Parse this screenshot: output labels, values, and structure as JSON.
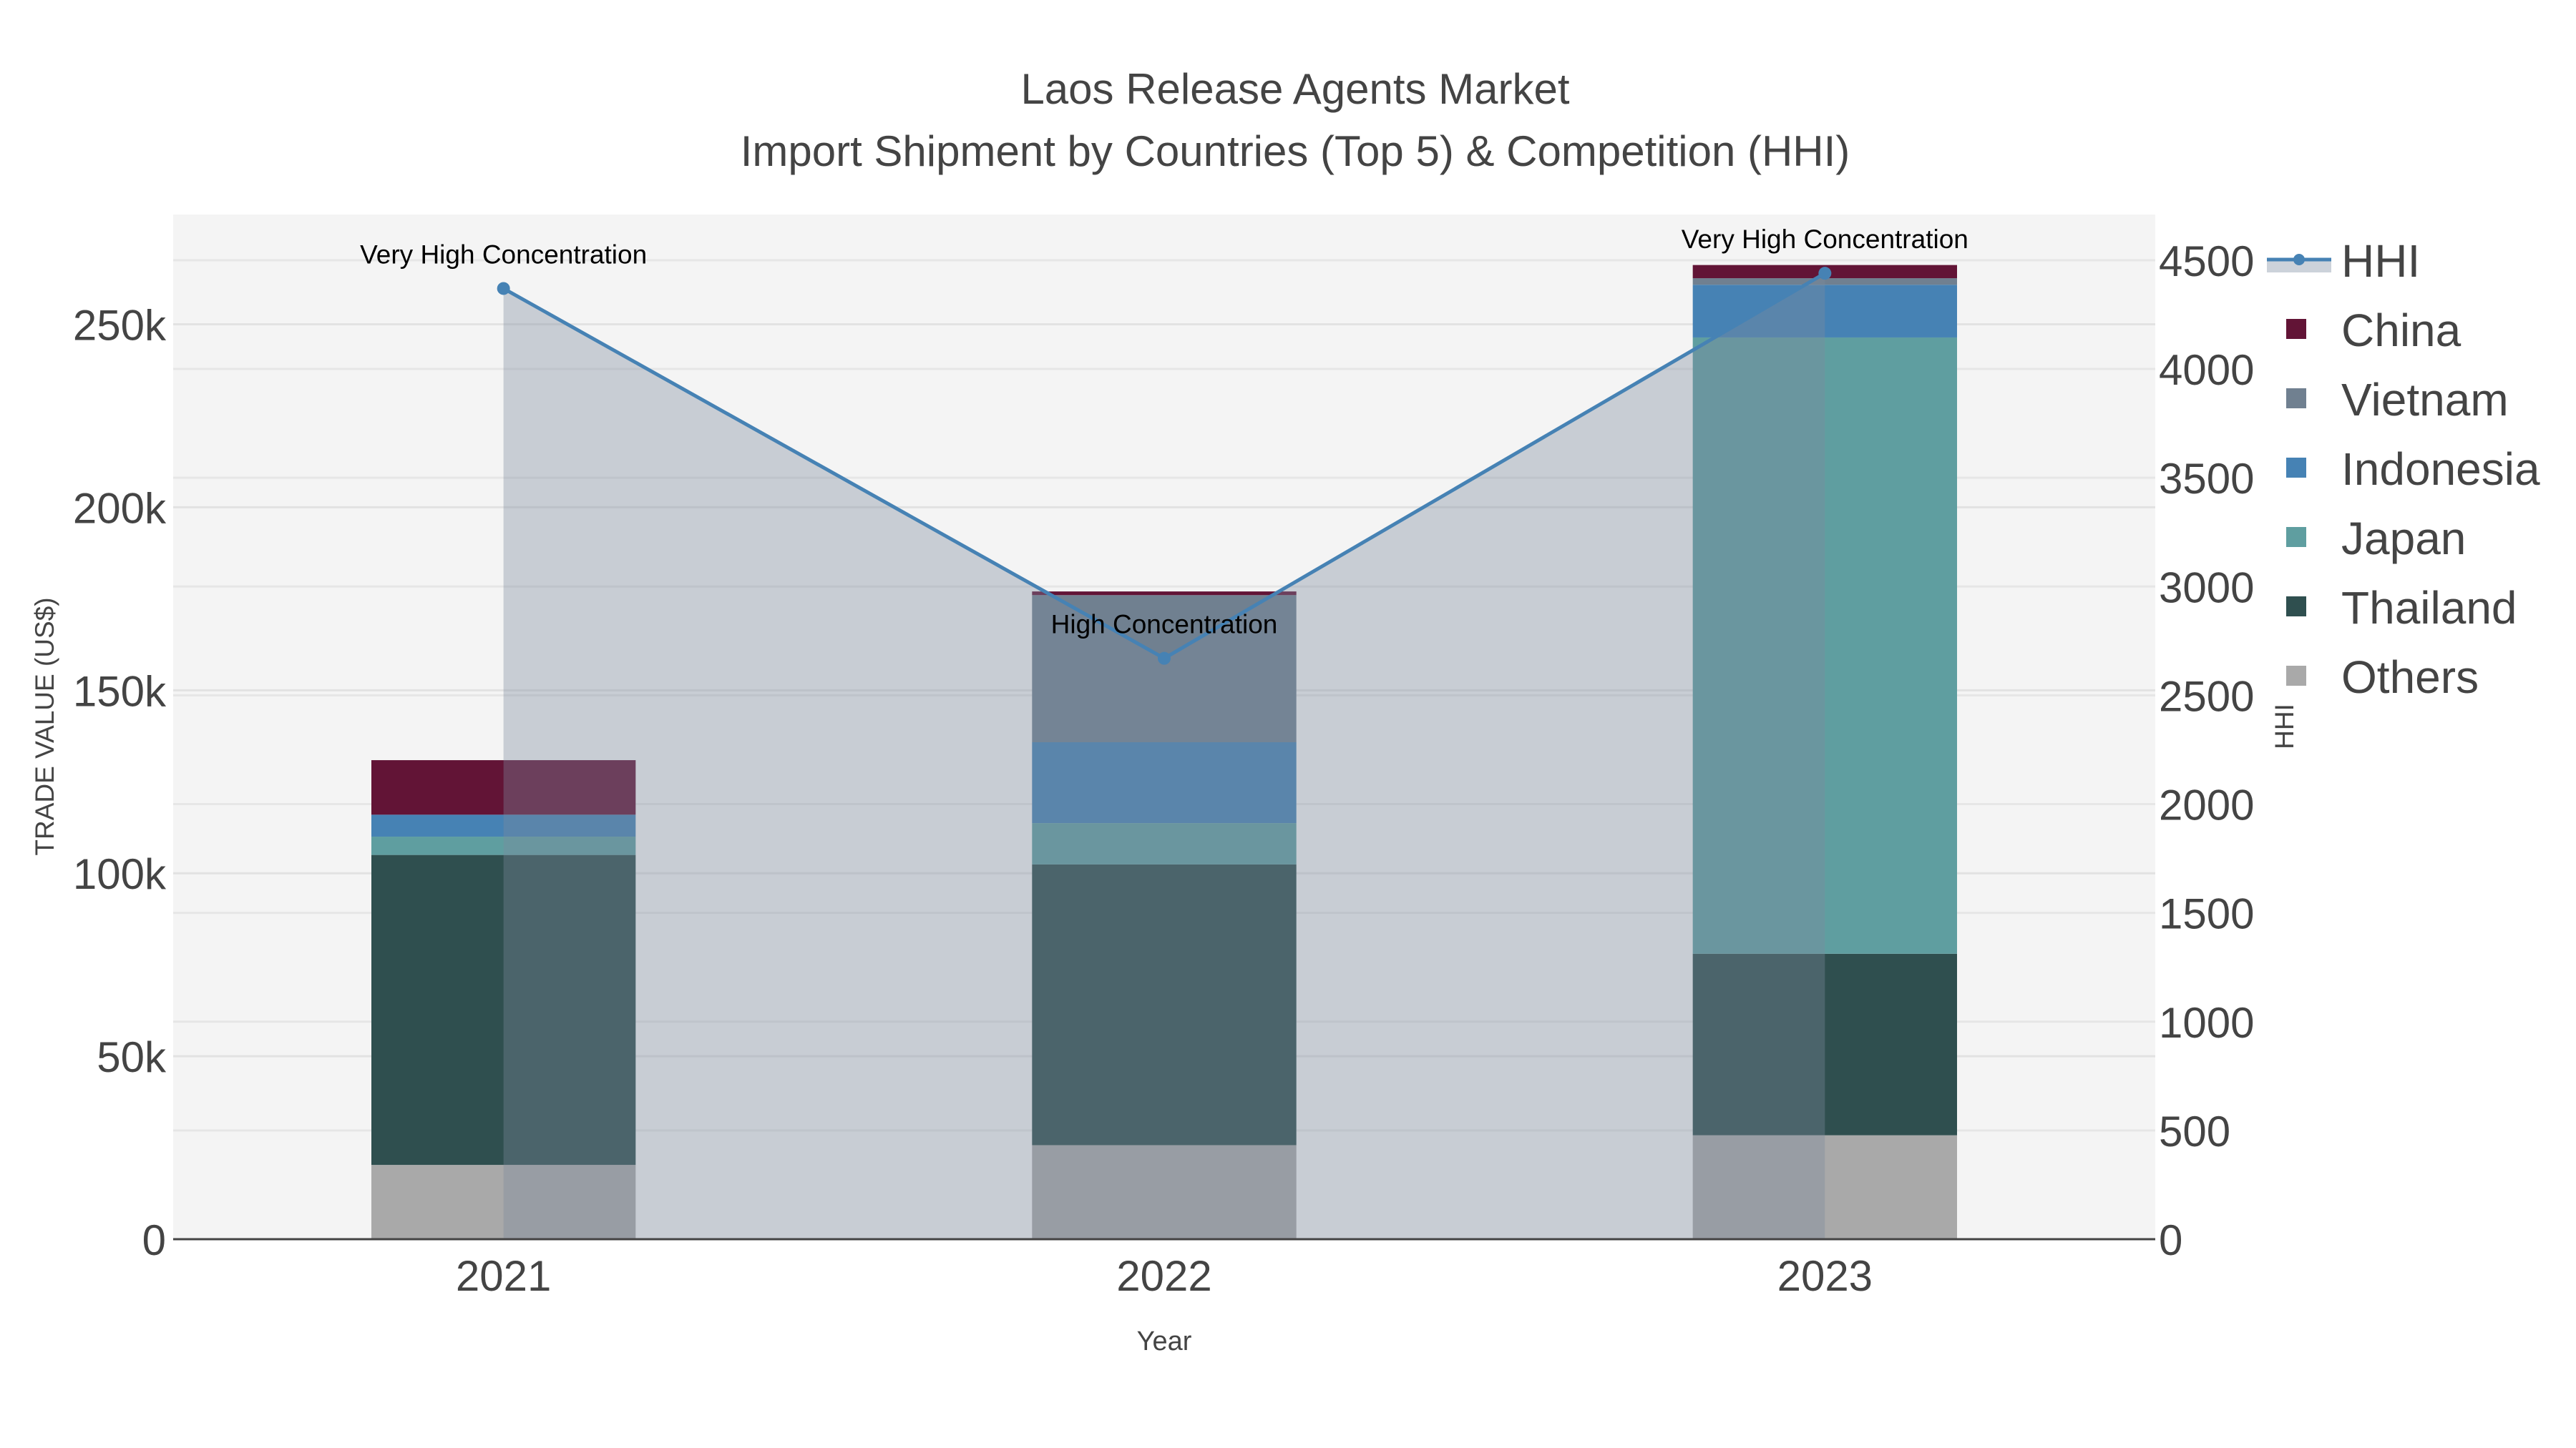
{
  "chart_data": {
    "type": "bar",
    "title_line1": "Laos Release Agents Market",
    "title_line2": "Import Shipment by Countries (Top 5) & Competition (HHI)",
    "xlabel": "Year",
    "ylabel": "TRADE VALUE (US$)",
    "y2label": "HHI",
    "categories": [
      "2021",
      "2022",
      "2023"
    ],
    "ylim": [
      0,
      280000
    ],
    "y2lim": [
      0,
      4710
    ],
    "yticks": [
      0,
      50000,
      100000,
      150000,
      200000,
      250000
    ],
    "ytick_labels": [
      "0",
      "50k",
      "100k",
      "150k",
      "200k",
      "250k"
    ],
    "y2ticks": [
      0,
      500,
      1000,
      1500,
      2000,
      2500,
      3000,
      3500,
      4000,
      4500
    ],
    "y2tick_labels": [
      "0",
      "500",
      "1000",
      "1500",
      "2000",
      "2500",
      "3000",
      "3500",
      "4000",
      "4500"
    ],
    "series": [
      {
        "name": "Others",
        "color": "#a9a9a9",
        "values": [
          20300,
          25700,
          28400
        ]
      },
      {
        "name": "Thailand",
        "color": "#2f4f4f",
        "values": [
          84700,
          76700,
          49600
        ]
      },
      {
        "name": "Japan",
        "color": "#5f9ea0",
        "values": [
          5000,
          11300,
          168400
        ]
      },
      {
        "name": "Indonesia",
        "color": "#4682b4",
        "values": [
          6000,
          22100,
          14400
        ]
      },
      {
        "name": "Vietnam",
        "color": "#708090",
        "values": [
          0,
          40200,
          1800
        ]
      },
      {
        "name": "China",
        "color": "#621436",
        "values": [
          14900,
          1000,
          3600
        ]
      }
    ],
    "hhi": {
      "name": "HHI",
      "color": "#4682b4",
      "values": [
        4370,
        2670,
        4440
      ]
    },
    "annotations": [
      "Very High Concentration",
      "High Concentration",
      "Very High Concentration"
    ],
    "legend_order": [
      "HHI",
      "China",
      "Vietnam",
      "Indonesia",
      "Japan",
      "Thailand",
      "Others"
    ],
    "legend_placement": "right",
    "grid": true
  }
}
